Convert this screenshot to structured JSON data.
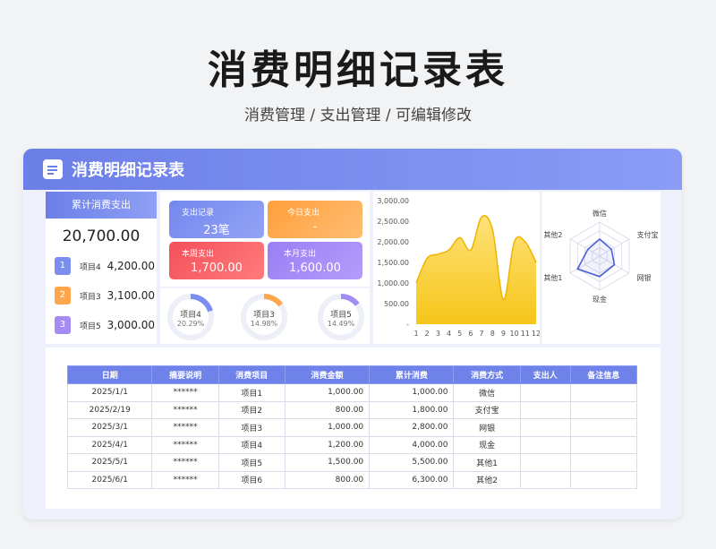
{
  "hero": {
    "title": "消费明细记录表",
    "subtitle": "消费管理 / 支出管理 /  可编辑修改"
  },
  "card": {
    "title": "消费明细记录表"
  },
  "summary": {
    "header": "累计消费支出",
    "total": "20,700.00",
    "ranks": [
      {
        "rank": "1",
        "name": "项目4",
        "value": "4,200.00",
        "color": "#7b8ef0"
      },
      {
        "rank": "2",
        "name": "项目3",
        "value": "3,100.00",
        "color": "#ffa64d"
      },
      {
        "rank": "3",
        "name": "项目5",
        "value": "3,000.00",
        "color": "#a58cf5"
      }
    ]
  },
  "stats": {
    "records": {
      "label": "支出记录",
      "value": "23笔"
    },
    "today": {
      "label": "今日支出",
      "value": "-"
    },
    "week": {
      "label": "本周支出",
      "value": "1,700.00"
    },
    "month": {
      "label": "本月支出",
      "value": "1,600.00"
    }
  },
  "donuts": [
    {
      "name": "项目4",
      "pct": "20.29%",
      "fraction": 0.2029,
      "color": "#7b8ef0"
    },
    {
      "name": "项目3",
      "pct": "14.98%",
      "fraction": 0.1498,
      "color": "#ffa64d"
    },
    {
      "name": "项目5",
      "pct": "14.49%",
      "fraction": 0.1449,
      "color": "#a58cf5"
    }
  ],
  "chart_data": [
    {
      "type": "area",
      "x": [
        "1",
        "2",
        "3",
        "4",
        "5",
        "6",
        "7",
        "8",
        "9",
        "10",
        "11",
        "12"
      ],
      "values": [
        1000,
        1600,
        1700,
        1800,
        2100,
        1800,
        2600,
        2300,
        600,
        2000,
        2000,
        1500
      ],
      "yticks": [
        "3,000.00",
        "2,500.00",
        "2,000.00",
        "1,500.00",
        "1,000.00",
        "500.00",
        "-"
      ],
      "ylim": [
        0,
        3000
      ],
      "color": "#f5c518"
    },
    {
      "type": "radar",
      "axes": [
        "微信",
        "支付宝",
        "网银",
        "现金",
        "其他1",
        "其他2"
      ],
      "values": [
        1000,
        800,
        1000,
        1200,
        1500,
        800
      ],
      "max": 2000,
      "color": "#4a5fd8"
    }
  ],
  "table": {
    "headers": [
      "日期",
      "摘要说明",
      "消费项目",
      "消费金额",
      "累计消费",
      "消费方式",
      "支出人",
      "备注信息"
    ],
    "rows": [
      [
        "2025/1/1",
        "******",
        "项目1",
        "1,000.00",
        "1,000.00",
        "微信",
        "",
        ""
      ],
      [
        "2025/2/19",
        "******",
        "项目2",
        "800.00",
        "1,800.00",
        "支付宝",
        "",
        ""
      ],
      [
        "2025/3/1",
        "******",
        "项目3",
        "1,000.00",
        "2,800.00",
        "网银",
        "",
        ""
      ],
      [
        "2025/4/1",
        "******",
        "项目4",
        "1,200.00",
        "4,000.00",
        "现金",
        "",
        ""
      ],
      [
        "2025/5/1",
        "******",
        "项目5",
        "1,500.00",
        "5,500.00",
        "其他1",
        "",
        ""
      ],
      [
        "2025/6/1",
        "******",
        "项目6",
        "800.00",
        "6,300.00",
        "其他2",
        "",
        ""
      ]
    ]
  }
}
